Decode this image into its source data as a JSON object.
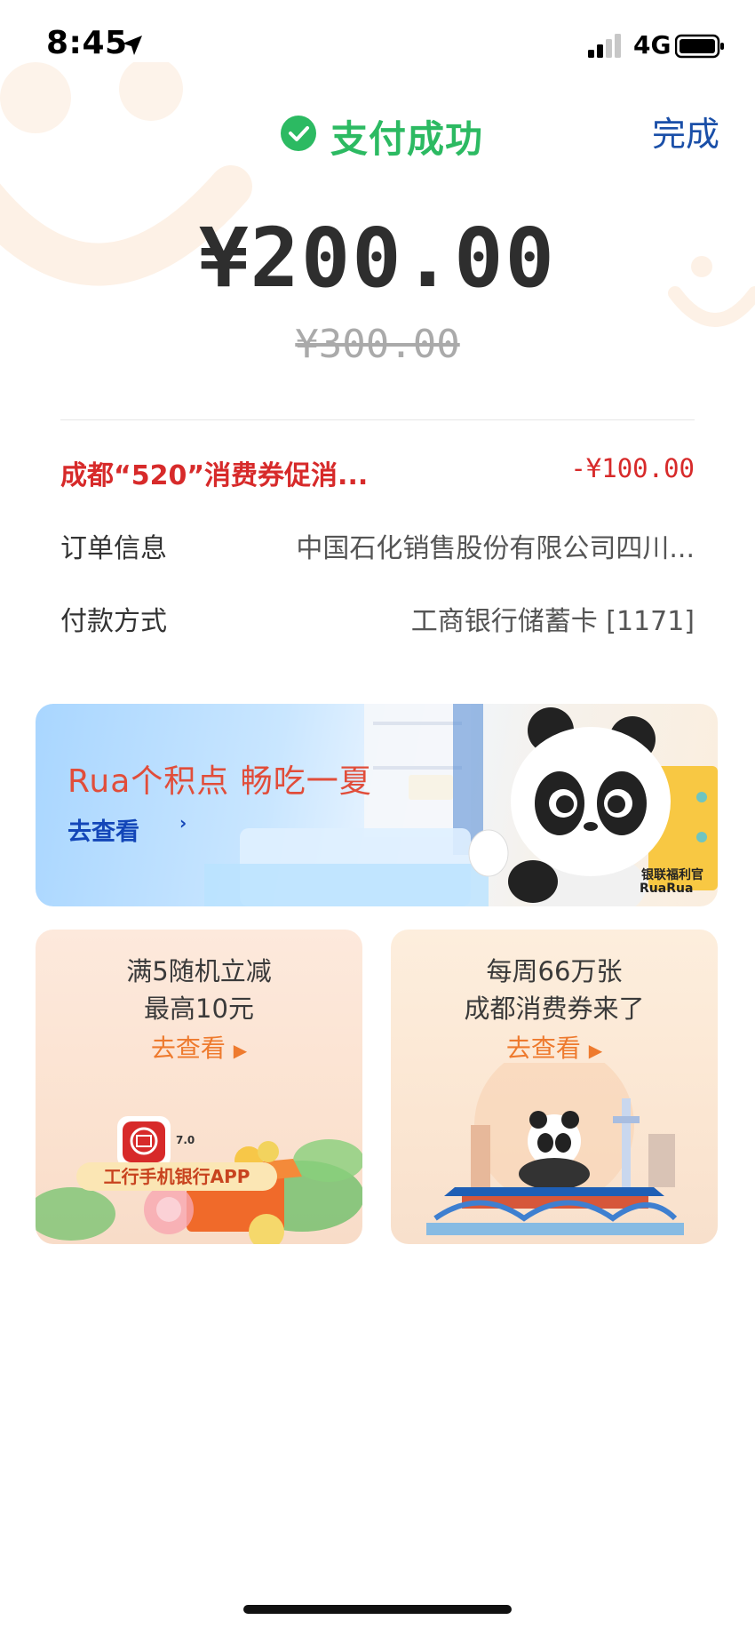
{
  "status_bar": {
    "time": "8:45",
    "network": "4G"
  },
  "header": {
    "title": "支付成功",
    "done_label": "完成"
  },
  "payment": {
    "amount": "¥200.00",
    "original_amount": "¥300.00"
  },
  "details": {
    "promo_label": "成都“520”消费券促消...",
    "promo_value": "-¥100.00",
    "order_label": "订单信息",
    "order_value": "中国石化销售股份有限公司四川...",
    "payment_label": "付款方式",
    "payment_value": "工商银行储蓄卡 [1171]"
  },
  "banner": {
    "title": "Rua个积点 畅吃一夏",
    "link": "去查看",
    "brand_line1": "银联福利官",
    "brand_line2": "RuaRua"
  },
  "cards": [
    {
      "line1": "满5随机立减",
      "line2": "最高10元",
      "link": "去查看",
      "badge": "工行手机银行APP",
      "version": "7.0"
    },
    {
      "line1": "每周66万张",
      "line2": "成都消费券来了",
      "link": "去查看"
    }
  ],
  "colors": {
    "success": "#2cba62",
    "done": "#1a4fa8",
    "promo": "#d72a2a",
    "link_orange": "#ee7a2e",
    "banner_title": "#e14d3a"
  }
}
